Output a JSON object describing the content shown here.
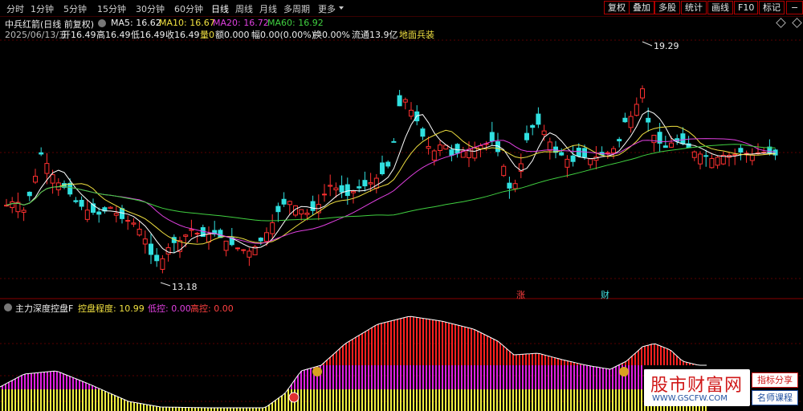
{
  "toolbar": {
    "tabs": [
      "分时",
      "1分钟",
      "5分钟",
      "15分钟",
      "30分钟",
      "60分钟",
      "日线",
      "周线",
      "月线",
      "多周期",
      "更多"
    ],
    "active_tab": "日线",
    "right_buttons": [
      "复权",
      "叠加",
      "多股",
      "统计",
      "画线",
      "F10",
      "标记"
    ],
    "minus": "−"
  },
  "stock": {
    "title": "中兵红箭(日线 前复权)",
    "ma5": "MA5: 16.62",
    "ma10": "MA10: 16.67",
    "ma20": "MA20: 16.72",
    "ma60": "MA60: 16.92"
  },
  "quote": {
    "date": "2025/06/13/五",
    "open": "开16.49",
    "high": "高16.49",
    "low": "低16.49",
    "close": "收16.49",
    "volume": "量0",
    "amount": "额0.000",
    "change": "幅0.00(0.00%)",
    "turnover": "换0.00%",
    "float": "流通13.9亿",
    "concept": "地面兵装"
  },
  "annotations": {
    "high_price": "19.29",
    "low_price": "13.18",
    "marker_zhang": "涨",
    "marker_cai": "财"
  },
  "indicator": {
    "title": "主力深度控盘F",
    "control": "控盘程度: 10.99",
    "low": "低控: 0.00",
    "high": "高控: 0.00"
  },
  "watermark": {
    "name": "股市财富网",
    "url": "WWW.GSCFW.COM",
    "tag1": "指标分享",
    "tag2": "名师课程"
  },
  "colors": {
    "up": "#ff3030",
    "down": "#30e0e0",
    "ma5": "#ffffff",
    "ma10": "#f0e040",
    "ma20": "#e040e0",
    "ma60": "#40d040",
    "bar_red": "#ff2020",
    "bar_magenta": "#e020e0",
    "bar_yellow": "#f0f040"
  },
  "chart_data": {
    "type": "candlestick",
    "price_range": [
      12.8,
      19.6
    ],
    "highest": 19.29,
    "lowest": 13.18,
    "indicator_series": [
      {
        "name": "控盘程度",
        "value": 10.99
      },
      {
        "name": "低控",
        "value": 0.0
      },
      {
        "name": "高控",
        "value": 0.0
      }
    ]
  }
}
